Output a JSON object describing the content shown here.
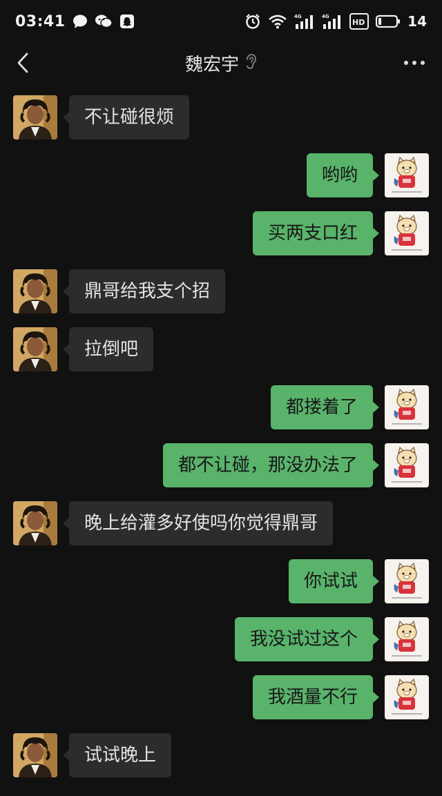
{
  "status_bar": {
    "time": "03:41",
    "battery": "14",
    "network_1": "4G",
    "network_2": "4G",
    "hd_label": "HD"
  },
  "header": {
    "contact_name": "魏宏宇"
  },
  "icons": {
    "back": "chevron-left",
    "more": "ellipsis",
    "voice_mode": "ear",
    "alarm": "alarm-clock",
    "wifi": "wifi",
    "chat_app": "speech-bubble",
    "wechat": "wechat-logo",
    "snapchat": "ghost"
  },
  "colors": {
    "background": "#111111",
    "incoming_bubble": "#2c2c2c",
    "outgoing_bubble": "#59b36b",
    "header_text": "#e6e6e6"
  },
  "messages": [
    {
      "side": "in",
      "text": "不让碰很烦"
    },
    {
      "side": "out",
      "text": "哟哟"
    },
    {
      "side": "out",
      "text": "买两支口红"
    },
    {
      "side": "in",
      "text": "鼎哥给我支个招"
    },
    {
      "side": "in",
      "text": "拉倒吧"
    },
    {
      "side": "out",
      "text": "都搂着了"
    },
    {
      "side": "out",
      "text": "都不让碰，那没办法了"
    },
    {
      "side": "in",
      "text": "晚上给灌多好使吗你觉得鼎哥"
    },
    {
      "side": "out",
      "text": "你试试"
    },
    {
      "side": "out",
      "text": "我没试过这个"
    },
    {
      "side": "out",
      "text": "我酒量不行"
    },
    {
      "side": "in",
      "text": "试试晚上"
    }
  ]
}
